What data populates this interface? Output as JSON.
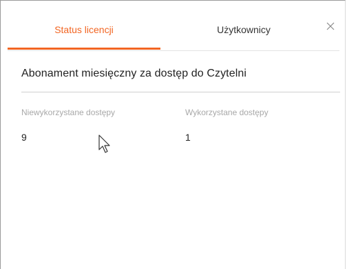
{
  "tabs": [
    {
      "label": "Status licencji",
      "active": true
    },
    {
      "label": "Użytkownicy",
      "active": false
    }
  ],
  "close_icon": "close-icon",
  "accent_color": "#f26522",
  "section": {
    "title": "Abonament miesięczny za dostęp do Czytelni"
  },
  "stats": {
    "unused": {
      "label": "Niewykorzystane dostępy",
      "value": "9"
    },
    "used": {
      "label": "Wykorzystane dostępy",
      "value": "1"
    }
  }
}
